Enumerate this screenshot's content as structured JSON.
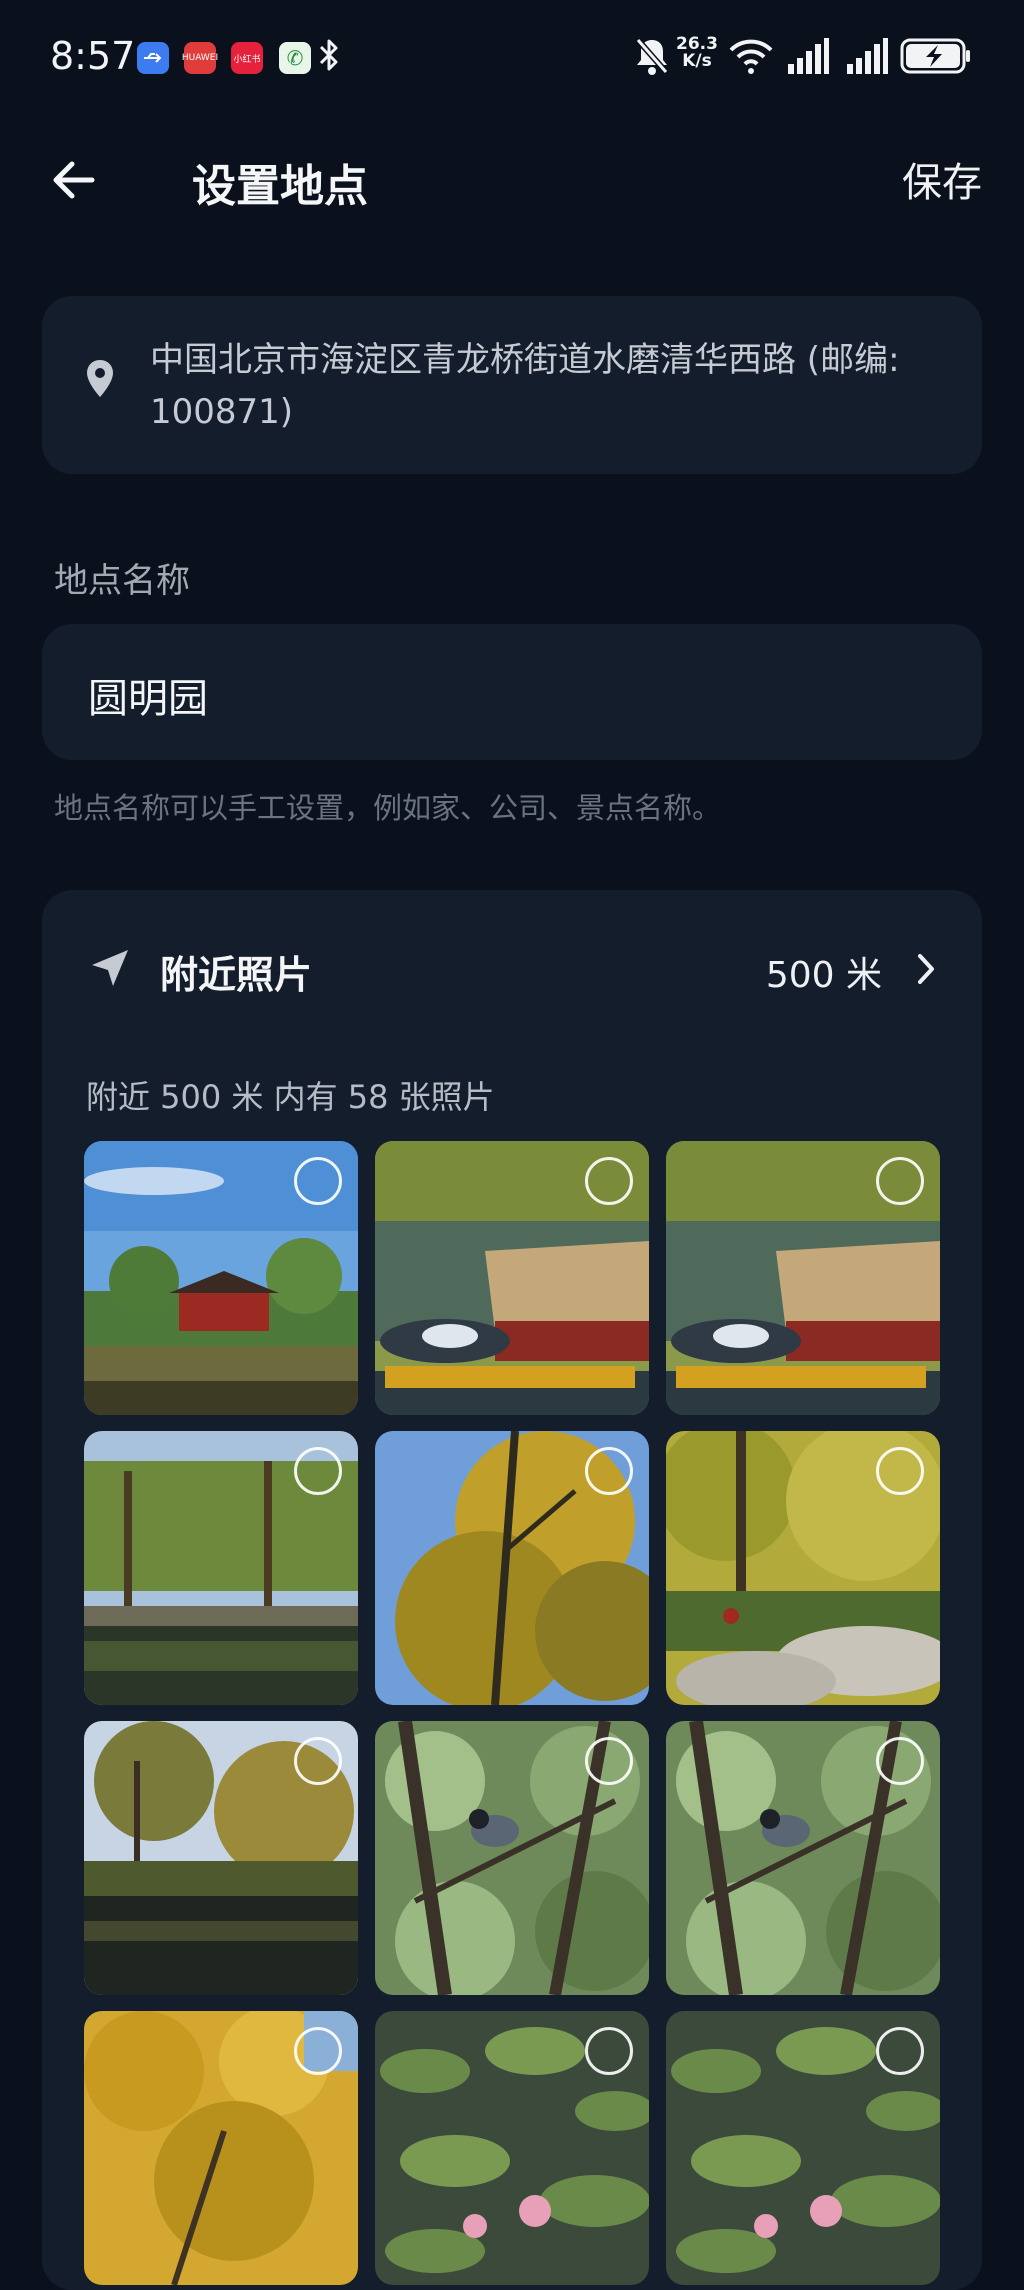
{
  "status": {
    "time": "8:57",
    "net_speed_value": "26.3",
    "net_speed_unit": "K/s",
    "notif_icons": [
      "usb-icon",
      "huawei-icon",
      "xiaohongshu-icon",
      "phone-icon"
    ],
    "notif_labels": [
      "",
      "HUAWEI",
      "小红书",
      "✆"
    ]
  },
  "header": {
    "title": "设置地点",
    "save_label": "保存"
  },
  "address": {
    "text": "中国北京市海淀区青龙桥街道水磨清华西路 (邮编: 100871)"
  },
  "place_name": {
    "label": "地点名称",
    "value": "圆明园",
    "hint": "地点名称可以手工设置，例如家、公司、景点名称。"
  },
  "nearby": {
    "title": "附近照片",
    "radius": "500 米",
    "count_text": "附近 500 米 内有 58 张照片",
    "photos": [
      {
        "name": "photo-pavilion-lake",
        "scene": "pavilion"
      },
      {
        "name": "photo-dragon-boat",
        "scene": "boat"
      },
      {
        "name": "photo-dragon-boat-2",
        "scene": "boat"
      },
      {
        "name": "photo-willow-pond",
        "scene": "willow"
      },
      {
        "name": "photo-yellow-tree",
        "scene": "yellowtree"
      },
      {
        "name": "photo-garden-rocks",
        "scene": "rocks"
      },
      {
        "name": "photo-autumn-river",
        "scene": "river"
      },
      {
        "name": "photo-bird-branch",
        "scene": "bird"
      },
      {
        "name": "photo-bird-branch-2",
        "scene": "bird"
      },
      {
        "name": "photo-golden-leaves",
        "scene": "golden"
      },
      {
        "name": "photo-lotus-pond",
        "scene": "lotus"
      },
      {
        "name": "photo-lotus-pond-2",
        "scene": "lotus"
      }
    ]
  },
  "colors": {
    "background": "#0b111c",
    "card": "#131d2c",
    "text_primary": "#f4f5f7",
    "text_secondary": "#a3a9b3",
    "text_hint": "#6b7380"
  }
}
